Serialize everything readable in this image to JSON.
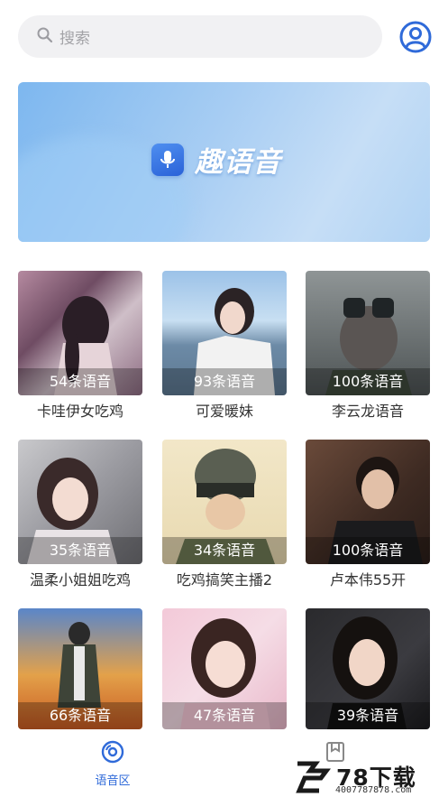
{
  "search": {
    "placeholder": "搜索",
    "icon": "search-icon"
  },
  "header": {
    "profile_icon": "user-circle-icon",
    "accent": "#2f6ad9"
  },
  "banner": {
    "title": "趣语音",
    "icon": "microphone-icon"
  },
  "cards": [
    {
      "count": "54条语音",
      "title": "卡哇伊女吃鸡"
    },
    {
      "count": "93条语音",
      "title": "可爱暖妹"
    },
    {
      "count": "100条语音",
      "title": "李云龙语音"
    },
    {
      "count": "35条语音",
      "title": "温柔小姐姐吃鸡"
    },
    {
      "count": "34条语音",
      "title": "吃鸡搞笑主播2"
    },
    {
      "count": "100条语音",
      "title": "卢本伟55开"
    },
    {
      "count": "66条语音",
      "title": ""
    },
    {
      "count": "47条语音",
      "title": ""
    },
    {
      "count": "39条语音",
      "title": ""
    }
  ],
  "tabbar": {
    "tabs": [
      {
        "label": "语音区",
        "icon": "disc-icon",
        "active": true
      },
      {
        "label": "",
        "icon": "bookmark-icon",
        "active": false
      }
    ]
  },
  "watermark": {
    "text": "78下载",
    "sub": "4007787878.com"
  }
}
